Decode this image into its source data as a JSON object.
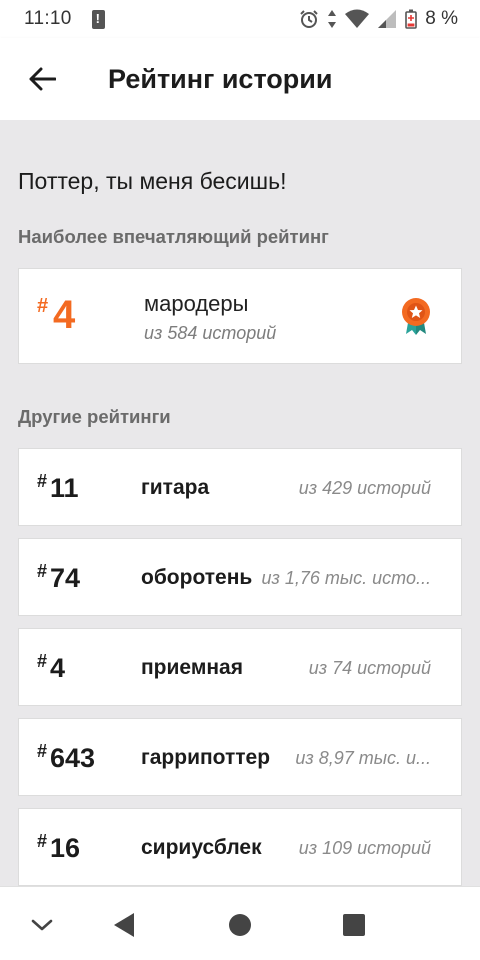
{
  "status": {
    "time": "11:10",
    "battery": "8 %"
  },
  "app_bar": {
    "title": "Рейтинг истории"
  },
  "story": {
    "title": "Поттер, ты меня бесишь!"
  },
  "best": {
    "section_label": "Наиболее впечатляющий рейтинг",
    "hash": "#",
    "rank": "4",
    "tag": "мародеры",
    "sub": "из 584 историй"
  },
  "other": {
    "section_label": "Другие рейтинги",
    "items": [
      {
        "hash": "#",
        "rank": "11",
        "tag": "гитара",
        "sub": "из 429 историй"
      },
      {
        "hash": "#",
        "rank": "74",
        "tag": "оборотень",
        "sub": "из 1,76 тыс. исто..."
      },
      {
        "hash": "#",
        "rank": "4",
        "tag": "приемная",
        "sub": "из 74 историй"
      },
      {
        "hash": "#",
        "rank": "643",
        "tag": "гаррипоттер",
        "sub": "из 8,97 тыс. и..."
      },
      {
        "hash": "#",
        "rank": "16",
        "tag": "сириусблек",
        "sub": "из 109 историй"
      }
    ]
  },
  "colors": {
    "accent": "#f36a21",
    "badge_ribbon": "#2aa39a"
  },
  "icons": {
    "back": "arrow-left-icon",
    "badge": "award-badge-icon",
    "nav": [
      "chevron-down-icon",
      "back-triangle-icon",
      "home-circle-icon",
      "recents-square-icon"
    ]
  }
}
